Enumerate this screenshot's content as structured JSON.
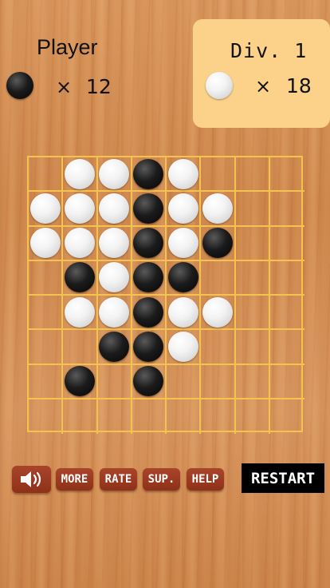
{
  "player": {
    "name": "Player",
    "stone_color": "black",
    "times_symbol": "×",
    "count": "12"
  },
  "cpu": {
    "name": "Div. 1",
    "stone_color": "white",
    "times_symbol": "×",
    "count": "18",
    "panel_color": "#fcd28a"
  },
  "board": {
    "size": 8,
    "line_color": "#f4c24e",
    "cells": [
      [
        ".",
        "W",
        "W",
        "B",
        "W",
        ".",
        ".",
        "."
      ],
      [
        "W",
        "W",
        "W",
        "B",
        "W",
        "W",
        ".",
        "."
      ],
      [
        "W",
        "W",
        "W",
        "B",
        "W",
        "B",
        ".",
        "."
      ],
      [
        ".",
        "B",
        "W",
        "B",
        "B",
        ".",
        ".",
        "."
      ],
      [
        ".",
        "W",
        "W",
        "B",
        "W",
        "W",
        ".",
        "."
      ],
      [
        ".",
        ".",
        "B",
        "B",
        "W",
        ".",
        ".",
        "."
      ],
      [
        ".",
        "B",
        ".",
        "B",
        ".",
        ".",
        ".",
        "."
      ],
      [
        ".",
        ".",
        ".",
        ".",
        ".",
        ".",
        ".",
        "."
      ]
    ]
  },
  "buttons": {
    "sound_icon": "speaker-icon",
    "more": "MORE",
    "rate": "RATE",
    "support": "SUP.",
    "help": "HELP",
    "restart": "RESTART"
  },
  "colors": {
    "button_brown": "#a9442a",
    "restart_bg": "#000000"
  }
}
